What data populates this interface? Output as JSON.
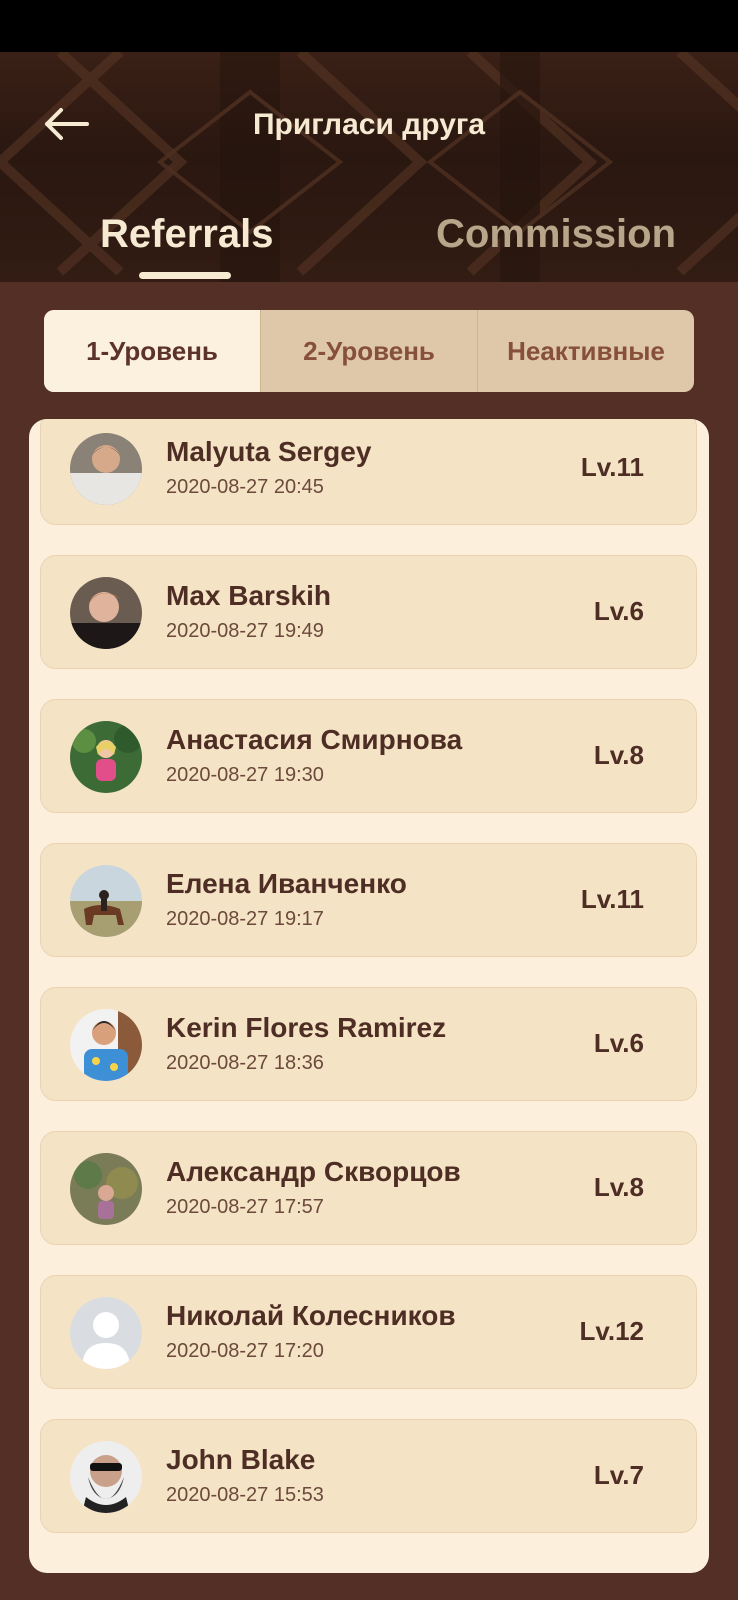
{
  "header": {
    "title": "Пригласи друга",
    "back_icon": "arrow-left-icon"
  },
  "main_tabs": [
    {
      "label": "Referrals",
      "active": true
    },
    {
      "label": "Commission",
      "active": false
    }
  ],
  "level_tabs": [
    {
      "label": "1-Уровень",
      "active": true
    },
    {
      "label": "2-Уровень",
      "active": false
    },
    {
      "label": "Неактивные",
      "active": false
    }
  ],
  "referrals": [
    {
      "name": "Malyuta Sergey",
      "date": "2020-08-27 20:45",
      "level": "Lv.11"
    },
    {
      "name": "Max Barskih",
      "date": "2020-08-27 19:49",
      "level": "Lv.6"
    },
    {
      "name": "Анастасия Смирнова",
      "date": "2020-08-27 19:30",
      "level": "Lv.8"
    },
    {
      "name": "Елена Иванченко",
      "date": "2020-08-27 19:17",
      "level": "Lv.11"
    },
    {
      "name": "Kerin Flores Ramirez",
      "date": "2020-08-27 18:36",
      "level": "Lv.6"
    },
    {
      "name": "Александр Скворцов",
      "date": "2020-08-27 17:57",
      "level": "Lv.8"
    },
    {
      "name": "Николай Колесников",
      "date": "2020-08-27 17:20",
      "level": "Lv.12"
    },
    {
      "name": "John Blake",
      "date": "2020-08-27 15:53",
      "level": "Lv.7"
    }
  ],
  "colors": {
    "background": "#532f25",
    "panel": "#fcf0dc",
    "card": "#f5e3c6",
    "text_dark": "#4e2e24",
    "tab_active_text": "#f6ead3",
    "tab_inactive_text": "#b9a58a"
  }
}
